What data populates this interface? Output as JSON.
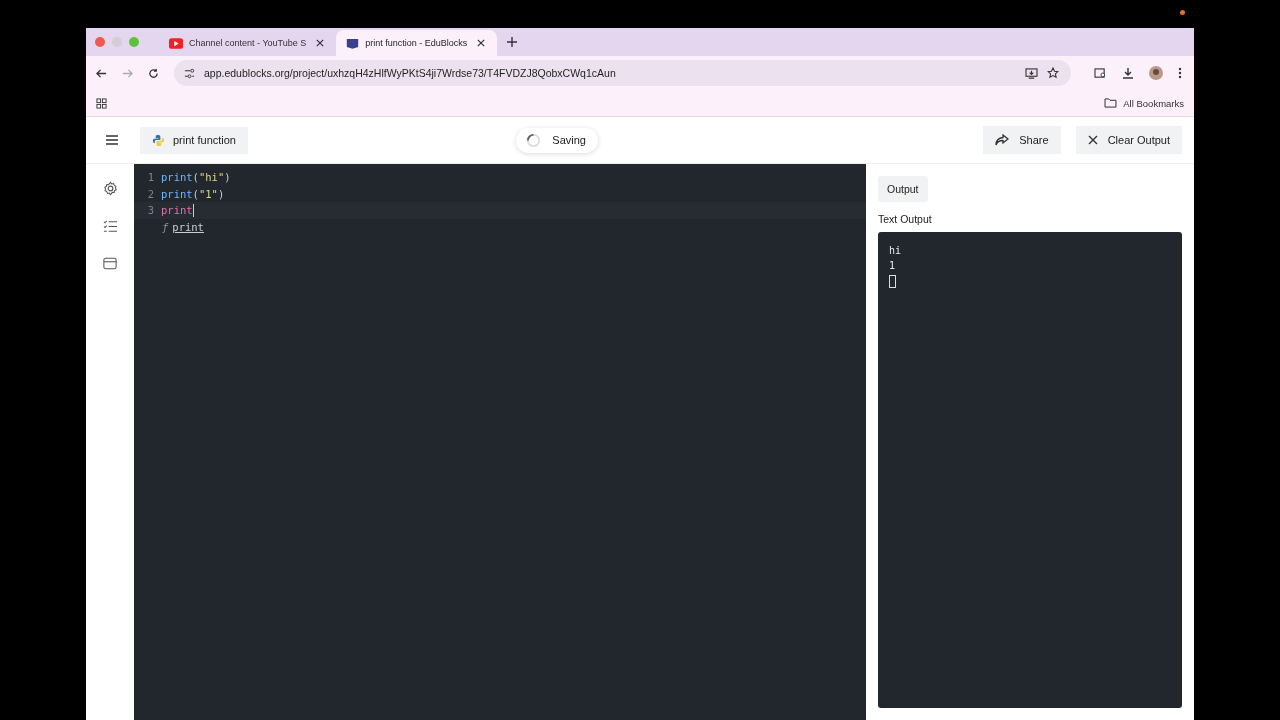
{
  "browser": {
    "tabs": [
      {
        "title": "Channel content - YouTube S",
        "kind": "video",
        "selected": false
      },
      {
        "title": "print function - EduBlocks",
        "kind": "edu",
        "selected": true
      }
    ],
    "url": "app.edublocks.org/project/uxhzqH4zHlfWyPKtS4ji7Wrdse73/T4FVDZJ8QobxCWq1cAun",
    "bookmarks": {
      "folder": "All Bookmarks"
    }
  },
  "app": {
    "project_name": "print function",
    "status": "Saving",
    "buttons": [
      {
        "label": "Share",
        "kind": "share"
      },
      {
        "label": "Clear Output",
        "kind": "clear"
      }
    ],
    "sidebar": [
      {
        "kind": "settings"
      },
      {
        "kind": "checklist"
      },
      {
        "kind": "package"
      }
    ]
  },
  "editor": {
    "lines": [
      {
        "number": "1",
        "parts": [
          {
            "text": "print",
            "kind": "name"
          },
          {
            "text": "(",
            "kind": "punct"
          },
          {
            "text": "\"hi\"",
            "kind": "string"
          },
          {
            "text": ")",
            "kind": "punct"
          }
        ]
      },
      {
        "number": "2",
        "parts": [
          {
            "text": "print",
            "kind": "name"
          },
          {
            "text": "(",
            "kind": "punct"
          },
          {
            "text": "\"1\"",
            "kind": "string"
          },
          {
            "text": ")",
            "kind": "punct"
          }
        ]
      },
      {
        "number": "3",
        "parts": [
          {
            "text": "print",
            "kind": "typing"
          }
        ]
      }
    ],
    "autocomplete": {
      "symbol": "ƒ",
      "label": "print"
    }
  },
  "output": {
    "tab": "Output",
    "heading": "Text Output",
    "lines": [
      "hi",
      "1"
    ],
    "cursor": true
  }
}
